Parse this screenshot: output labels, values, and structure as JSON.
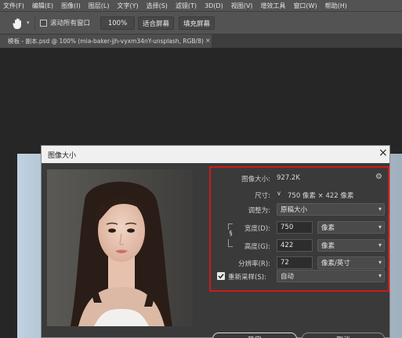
{
  "menu": {
    "items": [
      "文件(F)",
      "编辑(E)",
      "图像(I)",
      "图层(L)",
      "文字(Y)",
      "选择(S)",
      "滤镜(T)",
      "3D(D)",
      "视图(V)",
      "增效工具",
      "窗口(W)",
      "帮助(H)"
    ]
  },
  "options": {
    "scroll_all_label": "滚动所有窗口",
    "zoom_value": "100%",
    "fit_screen": "适合屏幕",
    "fill_screen": "填充屏幕"
  },
  "document_tab": {
    "title": "模板 - 副本.psd @ 100% (mia-baker-jjh-vyxm34nY-unsplash, RGB/8)",
    "close": "×"
  },
  "dialog": {
    "title": "图像大小",
    "close": "×",
    "image_size_label": "图像大小:",
    "image_size_value": "927.2K",
    "dimensions_label": "尺寸:",
    "dimensions_value": "750 像素 × 422 像素",
    "fit_to_label": "调整为:",
    "fit_to_value": "原稿大小",
    "width_label": "宽度(D):",
    "width_value": "750",
    "width_unit": "像素",
    "height_label": "高度(G):",
    "height_value": "422",
    "height_unit": "像素",
    "resolution_label": "分辨率(R):",
    "resolution_value": "72",
    "resolution_unit": "像素/英寸",
    "resample_label": "重新采样(S):",
    "resample_checked": true,
    "resample_value": "自动",
    "ok_label": "确定",
    "cancel_label": "取消"
  },
  "colors": {
    "highlight": "#d01818",
    "dialog_bg": "#3a3a3a",
    "titlebar_bg": "#f0f0f0"
  }
}
